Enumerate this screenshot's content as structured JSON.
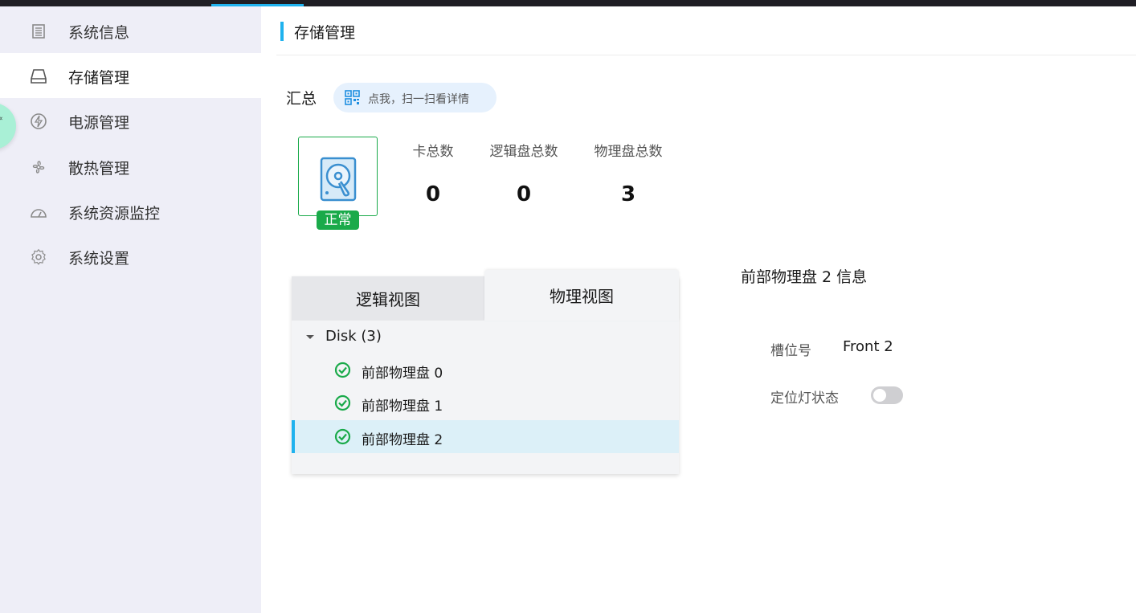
{
  "sidebar": {
    "items": [
      {
        "label": "系统信息",
        "icon": "document-list-icon",
        "active": false
      },
      {
        "label": "存储管理",
        "icon": "hard-drive-icon",
        "active": true
      },
      {
        "label": "电源管理",
        "icon": "power-icon",
        "active": false
      },
      {
        "label": "散热管理",
        "icon": "fan-icon",
        "active": false
      },
      {
        "label": "系统资源监控",
        "icon": "gauge-icon",
        "active": false
      },
      {
        "label": "系统设置",
        "icon": "gear-icon",
        "active": false
      }
    ]
  },
  "header": {
    "title": "存储管理"
  },
  "summary": {
    "label": "汇总",
    "scan_hint": "点我，扫一扫看详情",
    "status": "正常",
    "stats": [
      {
        "label": "卡总数",
        "value": "0"
      },
      {
        "label": "逻辑盘总数",
        "value": "0"
      },
      {
        "label": "物理盘总数",
        "value": "3"
      }
    ]
  },
  "tree": {
    "tabs": [
      {
        "label": "逻辑视图",
        "active": false
      },
      {
        "label": "物理视图",
        "active": true
      }
    ],
    "root_label": "Disk (3)",
    "items": [
      {
        "label": "前部物理盘 0",
        "status": "ok",
        "selected": false
      },
      {
        "label": "前部物理盘 1",
        "status": "ok",
        "selected": false
      },
      {
        "label": "前部物理盘 2",
        "status": "ok",
        "selected": true
      }
    ]
  },
  "detail": {
    "title": "前部物理盘 2 信息",
    "slot_label": "槽位号",
    "slot_value": "Front 2",
    "locate_label": "定位灯状态",
    "locate_on": false
  },
  "colors": {
    "accent": "#1fb2ee",
    "ok_green": "#1aaa4a",
    "sidebar_bg": "#eeeef7"
  }
}
